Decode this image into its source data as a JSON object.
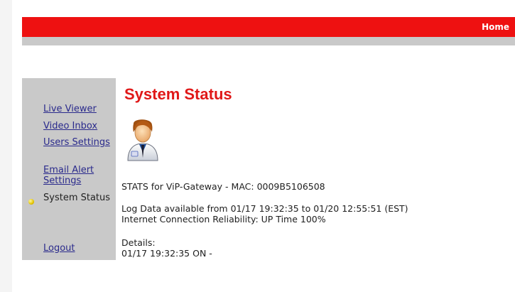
{
  "header": {
    "home_label": "Home"
  },
  "sidebar": {
    "items": [
      {
        "label": "Live Viewer"
      },
      {
        "label": "Video Inbox"
      },
      {
        "label": "Users Settings"
      },
      {
        "label": "Email Alert Settings"
      },
      {
        "label": "System Status",
        "current": true
      },
      {
        "label": "Logout"
      }
    ]
  },
  "main": {
    "title": "System Status",
    "user_icon": "user-avatar-icon",
    "stats_line": "STATS for ViP-Gateway - MAC: 0009B5106508",
    "log_line": "Log Data available from 01/17 19:32:35 to 01/20 12:55:51 (EST)",
    "reliability_line": "Internet Connection Reliability: UP Time 100%",
    "details_label": "Details:",
    "details_line": "01/17 19:32:35 ON -"
  },
  "colors": {
    "accent": "#ee1111",
    "sidebar_bg": "#c9c9c9",
    "title": "#e01818",
    "link": "#2a2a8c"
  }
}
